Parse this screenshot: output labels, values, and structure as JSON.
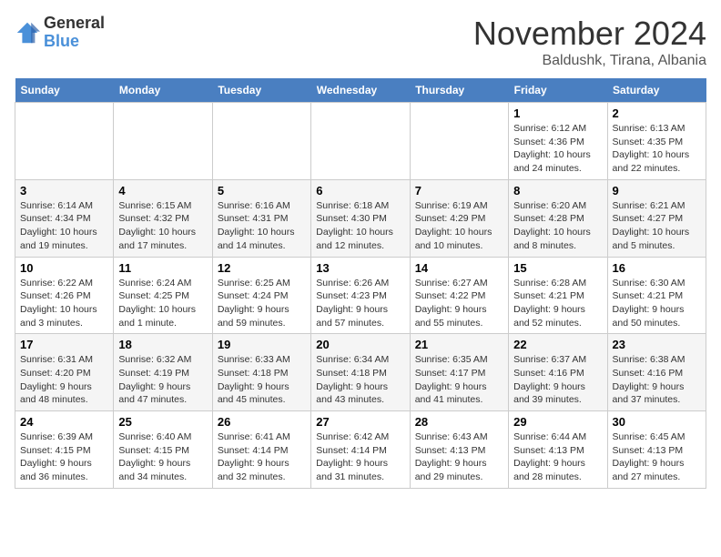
{
  "header": {
    "logo_line1": "General",
    "logo_line2": "Blue",
    "title": "November 2024",
    "subtitle": "Baldushk, Tirana, Albania"
  },
  "days_of_week": [
    "Sunday",
    "Monday",
    "Tuesday",
    "Wednesday",
    "Thursday",
    "Friday",
    "Saturday"
  ],
  "weeks": [
    [
      {
        "day": "",
        "info": ""
      },
      {
        "day": "",
        "info": ""
      },
      {
        "day": "",
        "info": ""
      },
      {
        "day": "",
        "info": ""
      },
      {
        "day": "",
        "info": ""
      },
      {
        "day": "1",
        "info": "Sunrise: 6:12 AM\nSunset: 4:36 PM\nDaylight: 10 hours and 24 minutes."
      },
      {
        "day": "2",
        "info": "Sunrise: 6:13 AM\nSunset: 4:35 PM\nDaylight: 10 hours and 22 minutes."
      }
    ],
    [
      {
        "day": "3",
        "info": "Sunrise: 6:14 AM\nSunset: 4:34 PM\nDaylight: 10 hours and 19 minutes."
      },
      {
        "day": "4",
        "info": "Sunrise: 6:15 AM\nSunset: 4:32 PM\nDaylight: 10 hours and 17 minutes."
      },
      {
        "day": "5",
        "info": "Sunrise: 6:16 AM\nSunset: 4:31 PM\nDaylight: 10 hours and 14 minutes."
      },
      {
        "day": "6",
        "info": "Sunrise: 6:18 AM\nSunset: 4:30 PM\nDaylight: 10 hours and 12 minutes."
      },
      {
        "day": "7",
        "info": "Sunrise: 6:19 AM\nSunset: 4:29 PM\nDaylight: 10 hours and 10 minutes."
      },
      {
        "day": "8",
        "info": "Sunrise: 6:20 AM\nSunset: 4:28 PM\nDaylight: 10 hours and 8 minutes."
      },
      {
        "day": "9",
        "info": "Sunrise: 6:21 AM\nSunset: 4:27 PM\nDaylight: 10 hours and 5 minutes."
      }
    ],
    [
      {
        "day": "10",
        "info": "Sunrise: 6:22 AM\nSunset: 4:26 PM\nDaylight: 10 hours and 3 minutes."
      },
      {
        "day": "11",
        "info": "Sunrise: 6:24 AM\nSunset: 4:25 PM\nDaylight: 10 hours and 1 minute."
      },
      {
        "day": "12",
        "info": "Sunrise: 6:25 AM\nSunset: 4:24 PM\nDaylight: 9 hours and 59 minutes."
      },
      {
        "day": "13",
        "info": "Sunrise: 6:26 AM\nSunset: 4:23 PM\nDaylight: 9 hours and 57 minutes."
      },
      {
        "day": "14",
        "info": "Sunrise: 6:27 AM\nSunset: 4:22 PM\nDaylight: 9 hours and 55 minutes."
      },
      {
        "day": "15",
        "info": "Sunrise: 6:28 AM\nSunset: 4:21 PM\nDaylight: 9 hours and 52 minutes."
      },
      {
        "day": "16",
        "info": "Sunrise: 6:30 AM\nSunset: 4:21 PM\nDaylight: 9 hours and 50 minutes."
      }
    ],
    [
      {
        "day": "17",
        "info": "Sunrise: 6:31 AM\nSunset: 4:20 PM\nDaylight: 9 hours and 48 minutes."
      },
      {
        "day": "18",
        "info": "Sunrise: 6:32 AM\nSunset: 4:19 PM\nDaylight: 9 hours and 47 minutes."
      },
      {
        "day": "19",
        "info": "Sunrise: 6:33 AM\nSunset: 4:18 PM\nDaylight: 9 hours and 45 minutes."
      },
      {
        "day": "20",
        "info": "Sunrise: 6:34 AM\nSunset: 4:18 PM\nDaylight: 9 hours and 43 minutes."
      },
      {
        "day": "21",
        "info": "Sunrise: 6:35 AM\nSunset: 4:17 PM\nDaylight: 9 hours and 41 minutes."
      },
      {
        "day": "22",
        "info": "Sunrise: 6:37 AM\nSunset: 4:16 PM\nDaylight: 9 hours and 39 minutes."
      },
      {
        "day": "23",
        "info": "Sunrise: 6:38 AM\nSunset: 4:16 PM\nDaylight: 9 hours and 37 minutes."
      }
    ],
    [
      {
        "day": "24",
        "info": "Sunrise: 6:39 AM\nSunset: 4:15 PM\nDaylight: 9 hours and 36 minutes."
      },
      {
        "day": "25",
        "info": "Sunrise: 6:40 AM\nSunset: 4:15 PM\nDaylight: 9 hours and 34 minutes."
      },
      {
        "day": "26",
        "info": "Sunrise: 6:41 AM\nSunset: 4:14 PM\nDaylight: 9 hours and 32 minutes."
      },
      {
        "day": "27",
        "info": "Sunrise: 6:42 AM\nSunset: 4:14 PM\nDaylight: 9 hours and 31 minutes."
      },
      {
        "day": "28",
        "info": "Sunrise: 6:43 AM\nSunset: 4:13 PM\nDaylight: 9 hours and 29 minutes."
      },
      {
        "day": "29",
        "info": "Sunrise: 6:44 AM\nSunset: 4:13 PM\nDaylight: 9 hours and 28 minutes."
      },
      {
        "day": "30",
        "info": "Sunrise: 6:45 AM\nSunset: 4:13 PM\nDaylight: 9 hours and 27 minutes."
      }
    ]
  ]
}
